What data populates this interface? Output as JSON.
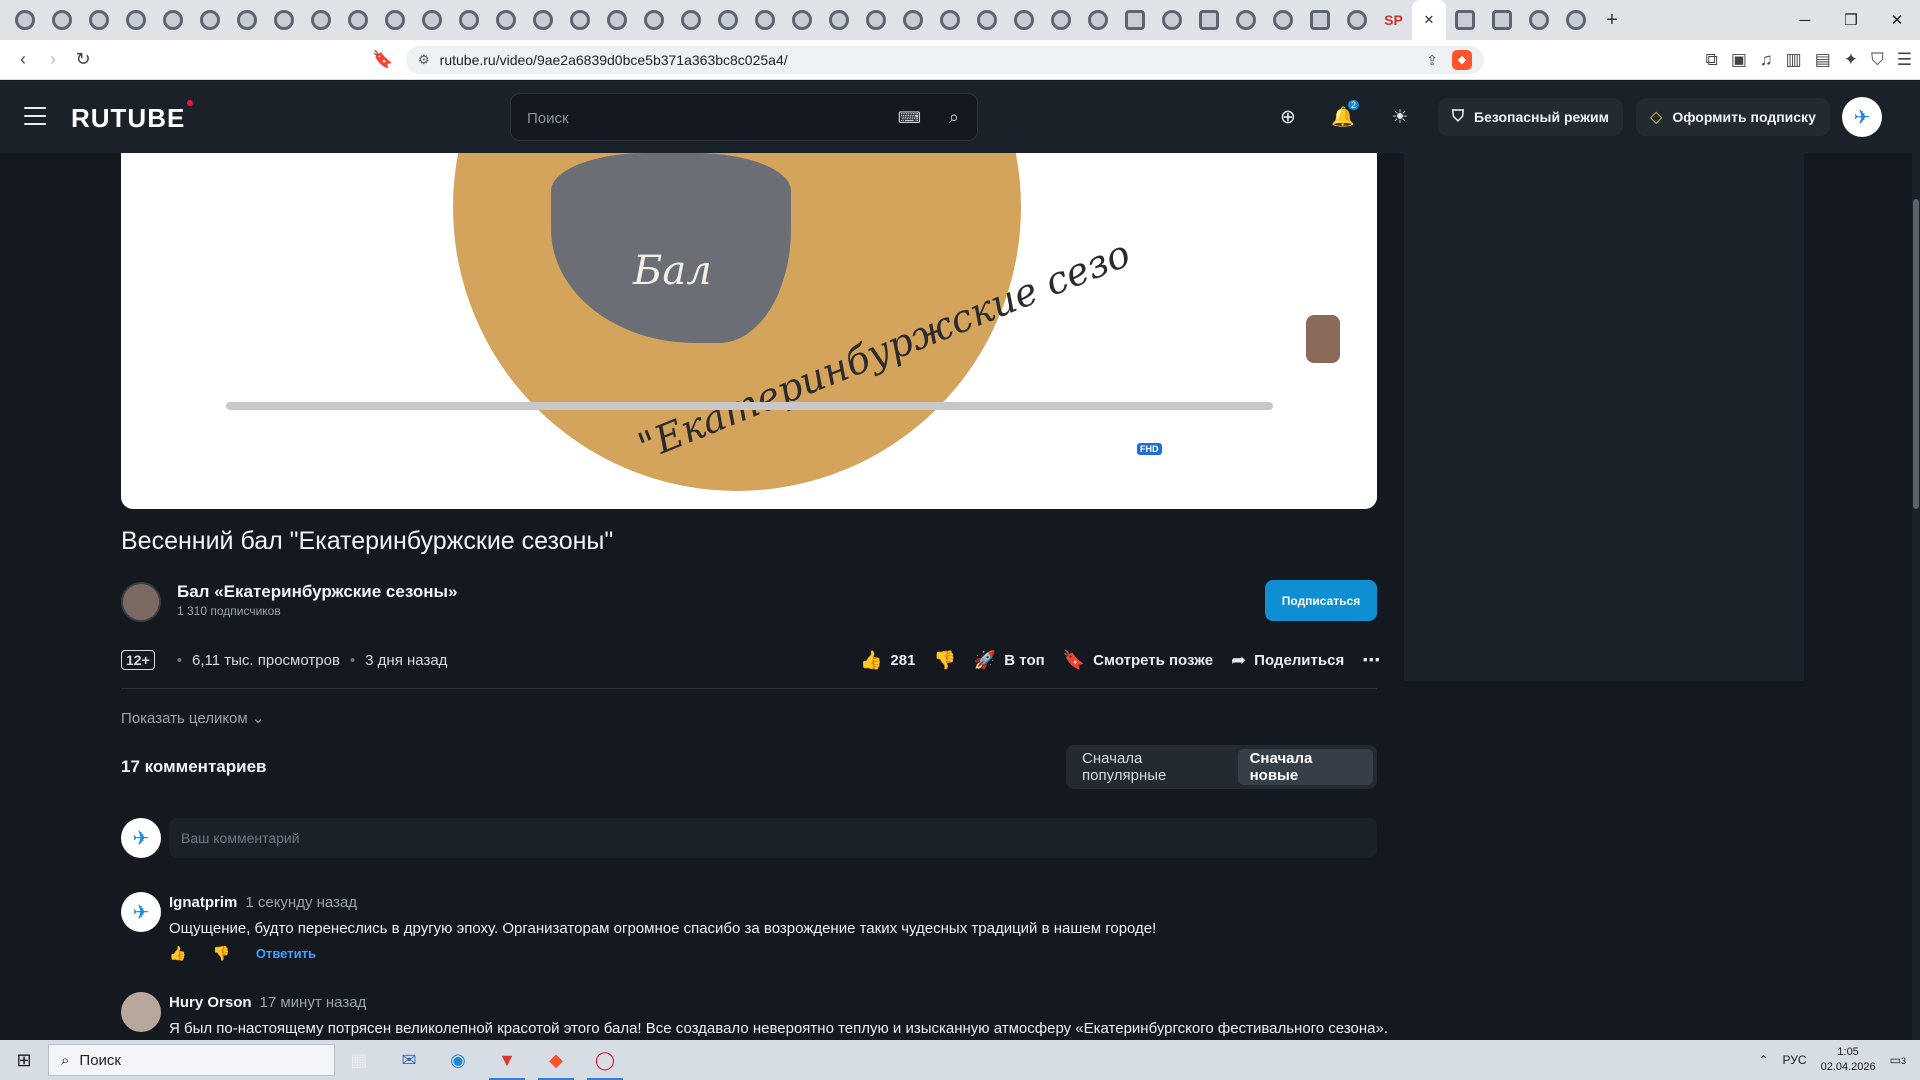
{
  "browser": {
    "url": "rutube.ru/video/9ae2a6839d0bce5b371a363bc8c025a4/",
    "tab_sp_label": "SP",
    "tab_close": "✕",
    "new_tab": "+"
  },
  "header": {
    "logo": "RUTUBE",
    "search_placeholder": "Поиск",
    "safe_mode": "Безопасный режим",
    "subscribe_plan": "Оформить подписку",
    "notifications_badge": "2"
  },
  "player": {
    "ball_word": "Бал",
    "arc_text": "\"Екатеринбуржские сезо",
    "quality_badge": "FHD"
  },
  "video": {
    "title": "Весенний бал \"Екатеринбуржские сезоны\"",
    "channel_name": "Бал «Екатеринбуржские сезоны»",
    "channel_subs": "1 310 подписчиков",
    "subscribe_label": "Подписаться",
    "age": "12+",
    "views": "6,11 тыс. просмотров",
    "posted": "3 дня назад",
    "likes": "281",
    "top_label": "В топ",
    "watch_later": "Смотреть позже",
    "share": "Поделиться",
    "show_more": "Показать целиком"
  },
  "comments": {
    "count_label": "17 комментариев",
    "sort_popular": "Сначала популярные",
    "sort_new": "Сначала новые",
    "input_placeholder": "Ваш комментарий",
    "reply_label": "Ответить",
    "items": [
      {
        "author": "Ignatprim",
        "time": "1 секунду назад",
        "text": "Ощущение, будто перенеслись в другую эпоху. Организаторам огромное спасибо за возрождение таких чудесных традиций в нашем городе!"
      },
      {
        "author": "Hury Orson",
        "time": "17 минут назад",
        "text": "Я был по-настоящему потрясен великолепной красотой этого бала! Все создавало невероятно теплую и изысканную атмосферу «Екатеринбургского фестивального сезона»."
      }
    ]
  },
  "taskbar": {
    "search_label": "Поиск",
    "lang": "РУС",
    "time": "1:05",
    "date": "02.04.2026",
    "notif_count": "3"
  },
  "colors": {
    "page_bg": "#14191f",
    "header_bg": "#1b2128",
    "accent_blue": "#0e8fd4",
    "logo_dot": "#ed143b",
    "reply_link": "#3aa3ff"
  }
}
